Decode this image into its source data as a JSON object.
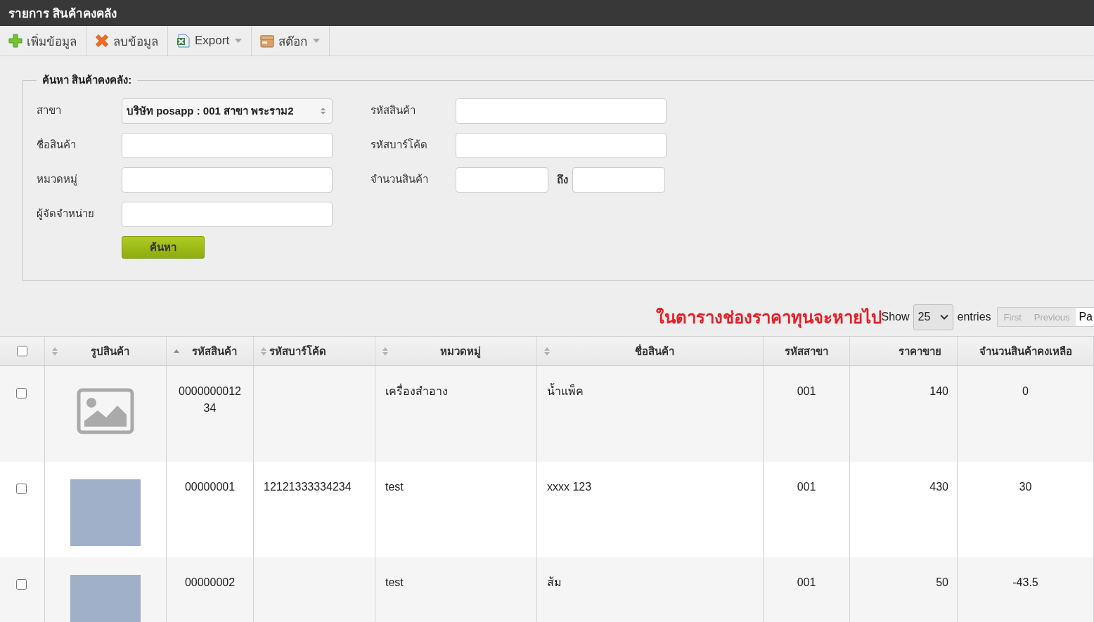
{
  "window": {
    "title": "รายการ สินค้าคงคลัง"
  },
  "toolbar": [
    {
      "kind": "add",
      "label": "เพิ่มข้อมูล",
      "dropdown": false
    },
    {
      "kind": "delete",
      "label": "ลบข้อมูล",
      "dropdown": false
    },
    {
      "kind": "export",
      "label": "Export",
      "dropdown": true
    },
    {
      "kind": "stock",
      "label": "สต๊อก",
      "dropdown": true
    }
  ],
  "search": {
    "legend": "ค้นหา สินค้าคงคลัง:",
    "left_fields": [
      {
        "kind": "select",
        "label": "สาขา",
        "value": "บริษัท posapp : 001 สาขา พระราม2"
      },
      {
        "kind": "text",
        "label": "ชื่อสินค้า"
      },
      {
        "kind": "text",
        "label": "หมวดหมู่"
      },
      {
        "kind": "text",
        "label": "ผู้จัดจำหน่าย"
      }
    ],
    "right_fields": [
      {
        "kind": "text",
        "label": "รหัสสินค้า"
      },
      {
        "kind": "text",
        "label": "รหัสบาร์โค้ด"
      },
      {
        "kind": "range",
        "label": "จำนวนสินค้า",
        "separator": "ถึง"
      }
    ],
    "button": "ค้นหา"
  },
  "notice": "ในตารางช่องราคาทุนจะหายไป",
  "length_menu": {
    "label_before": "Show",
    "value": "25",
    "label_after": "entries"
  },
  "pagination": [
    {
      "label": "First",
      "disabled": true
    },
    {
      "label": "Previous",
      "disabled": true
    },
    {
      "label": "Pa",
      "disabled": false
    }
  ],
  "table": {
    "select_all_checked": false,
    "columns": [
      {
        "kind": "sortable",
        "label": "รูปสินค้า"
      },
      {
        "kind": "sorted_ascending",
        "label": "รหัสสินค้า"
      },
      {
        "kind": "sortable",
        "label": "รหัสบาร์โค้ด"
      },
      {
        "kind": "sortable",
        "label": "หมวดหมู่"
      },
      {
        "kind": "sortable",
        "label": "ชื่อสินค้า"
      },
      {
        "kind": "plain",
        "label": "รหัสสาขา"
      },
      {
        "kind": "plain",
        "label": "ราคาขาย"
      },
      {
        "kind": "plain",
        "label": "จำนวนสินค้าคงเหลือ"
      }
    ],
    "rows": [
      {
        "checked": false,
        "has_photo": false,
        "product_code": "000000001234",
        "category": "เครื่องสำอาง",
        "name": "น้ำแพ็ค",
        "branch_code": "001",
        "price": "140",
        "stock": "0"
      },
      {
        "checked": false,
        "has_photo": true,
        "product_code": "00000001",
        "barcode": "12121333334234",
        "category": "test",
        "name": "xxxx 123",
        "branch_code": "001",
        "price": "430",
        "stock": "30"
      },
      {
        "checked": false,
        "has_photo": true,
        "product_code": "00000002",
        "category": "test",
        "name": "ส้ม",
        "branch_code": "001",
        "price": "50",
        "stock": "-43.5"
      }
    ]
  }
}
